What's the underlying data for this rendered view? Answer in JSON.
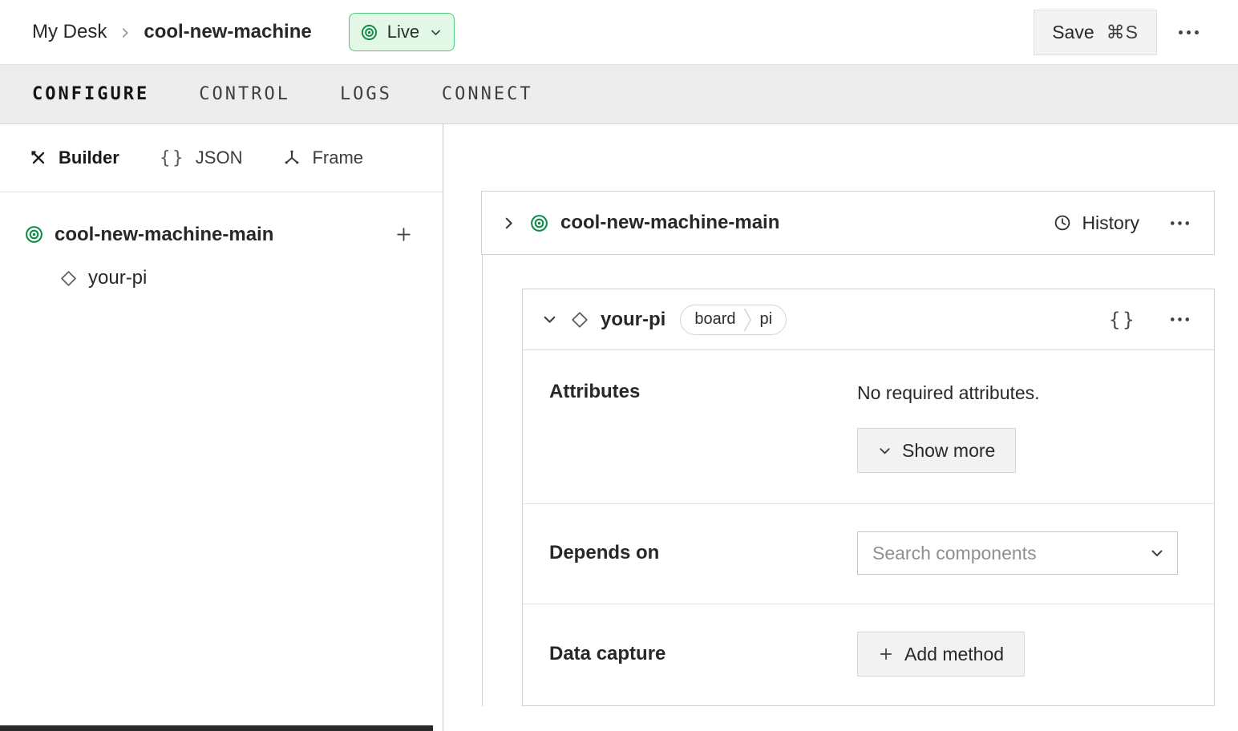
{
  "header": {
    "breadcrumb": {
      "root": "My Desk",
      "current": "cool-new-machine"
    },
    "live_badge": {
      "label": "Live"
    },
    "save": {
      "label": "Save",
      "shortcut": "⌘S"
    }
  },
  "tabs": [
    {
      "label": "CONFIGURE",
      "active": true
    },
    {
      "label": "CONTROL",
      "active": false
    },
    {
      "label": "LOGS",
      "active": false
    },
    {
      "label": "CONNECT",
      "active": false
    }
  ],
  "sidebar": {
    "modes": [
      {
        "label": "Builder",
        "active": true
      },
      {
        "label": "JSON",
        "active": false
      },
      {
        "label": "Frame",
        "active": false
      }
    ],
    "tree": {
      "root_label": "cool-new-machine-main",
      "child_label": "your-pi"
    }
  },
  "main": {
    "machine_card": {
      "title": "cool-new-machine-main",
      "history_label": "History"
    },
    "component_card": {
      "title": "your-pi",
      "badges": {
        "type": "board",
        "model": "pi"
      },
      "sections": {
        "attributes": {
          "label": "Attributes",
          "empty_text": "No required attributes.",
          "show_more_label": "Show more"
        },
        "depends_on": {
          "label": "Depends on",
          "search_placeholder": "Search components"
        },
        "data_capture": {
          "label": "Data capture",
          "add_method_label": "Add method"
        }
      }
    }
  },
  "icons": {
    "braces": "{}"
  },
  "colors": {
    "accent_green": "#0f8a4b",
    "live_badge_bg": "#e3f7e6",
    "live_badge_border": "#4fc878",
    "tab_bar_bg": "#ededed",
    "button_bg": "#f2f2f2",
    "card_border": "#d2d2d2"
  }
}
